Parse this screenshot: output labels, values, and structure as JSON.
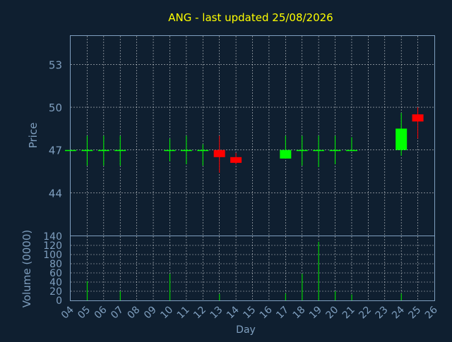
{
  "colors": {
    "background": "#0f1f30",
    "axis": "#7f9fbf",
    "title": "#ffff00",
    "grid": "#ffffff",
    "up": "#00ff00",
    "down": "#ff0000",
    "volume": "#00cc00"
  },
  "chart_data": [
    {
      "type": "candlestick",
      "title": "ANG - last updated 25/08/2026",
      "ylabel": "Price",
      "ylim": [
        41.0,
        55.0
      ],
      "yticks": [
        44,
        47,
        50,
        53
      ],
      "grid": true,
      "x_days": [
        "04",
        "05",
        "06",
        "07",
        "08",
        "09",
        "10",
        "11",
        "12",
        "13",
        "14",
        "15",
        "16",
        "17",
        "18",
        "19",
        "20",
        "21",
        "22",
        "23",
        "24",
        "25",
        "26"
      ],
      "candles": [
        {
          "day": "04",
          "open": 47.0,
          "high": 47.0,
          "low": 47.0,
          "close": 47.0
        },
        {
          "day": "05",
          "open": 47.0,
          "high": 48.0,
          "low": 45.9,
          "close": 47.0
        },
        {
          "day": "06",
          "open": 47.0,
          "high": 48.0,
          "low": 45.9,
          "close": 47.0
        },
        {
          "day": "07",
          "open": 47.0,
          "high": 48.0,
          "low": 45.9,
          "close": 47.0
        },
        {
          "day": "10",
          "open": 47.0,
          "high": 47.8,
          "low": 46.2,
          "close": 47.0
        },
        {
          "day": "11",
          "open": 47.0,
          "high": 48.0,
          "low": 46.0,
          "close": 47.0
        },
        {
          "day": "12",
          "open": 47.0,
          "high": 47.4,
          "low": 45.9,
          "close": 47.0
        },
        {
          "day": "13",
          "open": 47.0,
          "high": 48.0,
          "low": 45.4,
          "close": 46.5
        },
        {
          "day": "14",
          "open": 46.5,
          "high": 46.8,
          "low": 46.0,
          "close": 46.1
        },
        {
          "day": "17",
          "open": 46.4,
          "high": 48.0,
          "low": 46.4,
          "close": 47.0
        },
        {
          "day": "18",
          "open": 47.0,
          "high": 48.0,
          "low": 45.9,
          "close": 47.0
        },
        {
          "day": "19",
          "open": 47.0,
          "high": 48.0,
          "low": 45.8,
          "close": 47.0
        },
        {
          "day": "20",
          "open": 47.0,
          "high": 48.0,
          "low": 46.0,
          "close": 47.0
        },
        {
          "day": "21",
          "open": 47.0,
          "high": 47.9,
          "low": 47.0,
          "close": 47.0
        },
        {
          "day": "24",
          "open": 47.0,
          "high": 49.6,
          "low": 46.6,
          "close": 48.5
        },
        {
          "day": "25",
          "open": 49.5,
          "high": 50.0,
          "low": 47.8,
          "close": 49.0
        }
      ]
    },
    {
      "type": "bar",
      "ylabel": "Volume (0000)",
      "xlabel": "Day",
      "ylim": [
        0,
        140
      ],
      "yticks": [
        0,
        20,
        40,
        60,
        80,
        100,
        120,
        140
      ],
      "grid": true,
      "categories": [
        "05",
        "07",
        "10",
        "13",
        "17",
        "18",
        "19",
        "20",
        "21",
        "24"
      ],
      "values": [
        42,
        20,
        58,
        14,
        15,
        58,
        128,
        20,
        13,
        15
      ]
    }
  ]
}
